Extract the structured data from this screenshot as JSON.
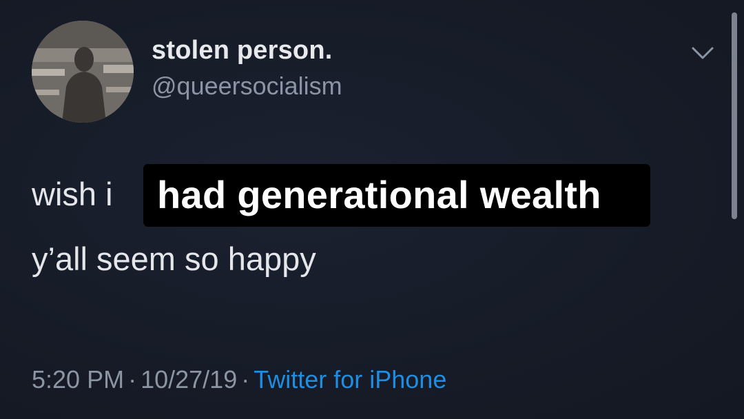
{
  "user": {
    "display_name": "stolen person.",
    "handle": "@queersocialism",
    "avatar_icon": "profile-avatar"
  },
  "menu": {
    "icon": "chevron-down-icon"
  },
  "tweet": {
    "line1_prefix": "wish i",
    "line1_highlight": "had generational wealth",
    "line2": "y’all seem so happy"
  },
  "meta": {
    "time": "5:20 PM",
    "separator": "·",
    "date": "10/27/19",
    "source": "Twitter for iPhone"
  },
  "colors": {
    "background": "#151a26",
    "link": "#1f8ee0",
    "muted": "#8c95a3",
    "text": "#e4e6ea",
    "highlight_bg": "#000000"
  }
}
